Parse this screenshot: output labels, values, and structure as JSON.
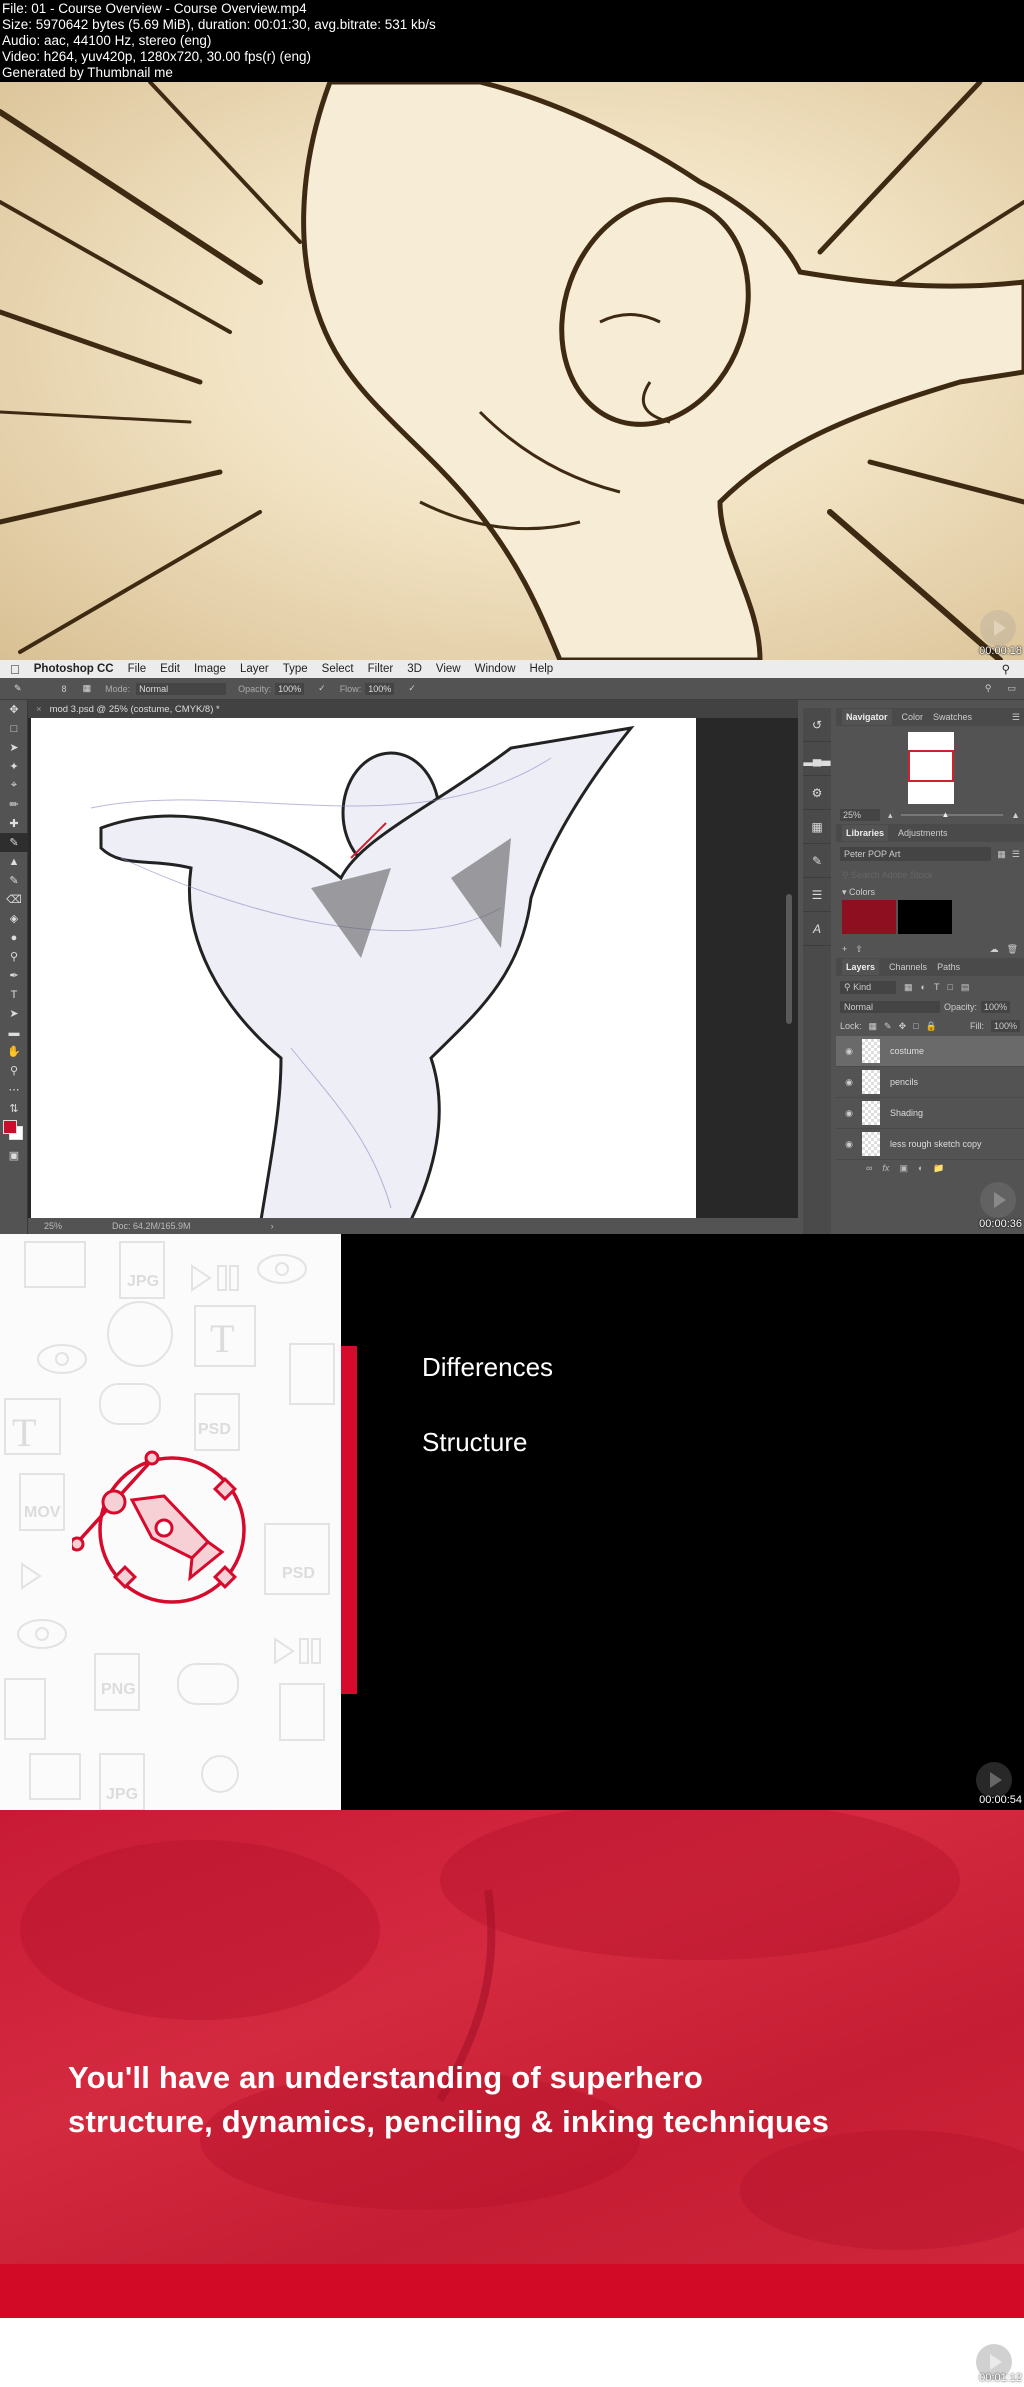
{
  "file_info": {
    "line1": "File: 01 - Course Overview - Course Overview.mp4",
    "line2": "Size: 5970642 bytes (5.69 MiB), duration: 00:01:30, avg.bitrate: 531 kb/s",
    "line3": "Audio: aac, 44100 Hz, stereo (eng)",
    "line4": "Video: h264, yuv420p, 1280x720, 30.00 fps(r) (eng)",
    "line5": "Generated by Thumbnail me"
  },
  "frames": [
    {
      "timestamp": "00:00:18",
      "description": "Inked superhero illustration on sepia background with speed lines"
    },
    {
      "timestamp": "00:00:36"
    },
    {
      "timestamp": "00:00:54"
    },
    {
      "timestamp": "00:01:12"
    }
  ],
  "photoshop": {
    "app_name": "Photoshop CC",
    "menu": [
      "File",
      "Edit",
      "Image",
      "Layer",
      "Type",
      "Select",
      "Filter",
      "3D",
      "View",
      "Window",
      "Help"
    ],
    "options": {
      "brush_size": "8",
      "mode_label": "Mode:",
      "mode_value": "Normal",
      "opacity_label": "Opacity:",
      "opacity_value": "100%",
      "flow_label": "Flow:",
      "flow_value": "100%"
    },
    "document_tab": "mod 3.psd @ 25% (costume, CMYK/8) *",
    "status": {
      "zoom": "25%",
      "doc": "Doc: 64.2M/165.9M"
    },
    "navigator": {
      "tabs": [
        "Navigator",
        "Color",
        "Swatches"
      ],
      "zoom": "25%"
    },
    "libraries": {
      "tabs": [
        "Libraries",
        "Adjustments"
      ],
      "library_name": "Peter POP Art",
      "search_placeholder": "Search Adobe Stock",
      "colors_label": "Colors",
      "swatches": [
        "#8e1020",
        "#000000"
      ]
    },
    "layers": {
      "tabs": [
        "Layers",
        "Channels",
        "Paths"
      ],
      "filter": "Kind",
      "blend_mode": "Normal",
      "opacity_label": "Opacity:",
      "opacity_value": "100%",
      "lock_label": "Lock:",
      "fill_label": "Fill:",
      "fill_value": "100%",
      "items": [
        {
          "name": "costume",
          "selected": true
        },
        {
          "name": "pencils",
          "selected": false
        },
        {
          "name": "Shading",
          "selected": false
        },
        {
          "name": "less rough sketch copy",
          "selected": false
        }
      ]
    },
    "foreground_color": "#c8102e",
    "background_color": "#ffffff"
  },
  "slide": {
    "items": [
      "Differences",
      "Structure"
    ],
    "accent": "#d60a2c",
    "pattern_labels": [
      "JPG",
      "PSD",
      "MOV",
      "PNG",
      "T"
    ]
  },
  "closing": {
    "line1": "You'll have an understanding of superhero",
    "line2": "structure, dynamics, penciling & inking techniques"
  }
}
